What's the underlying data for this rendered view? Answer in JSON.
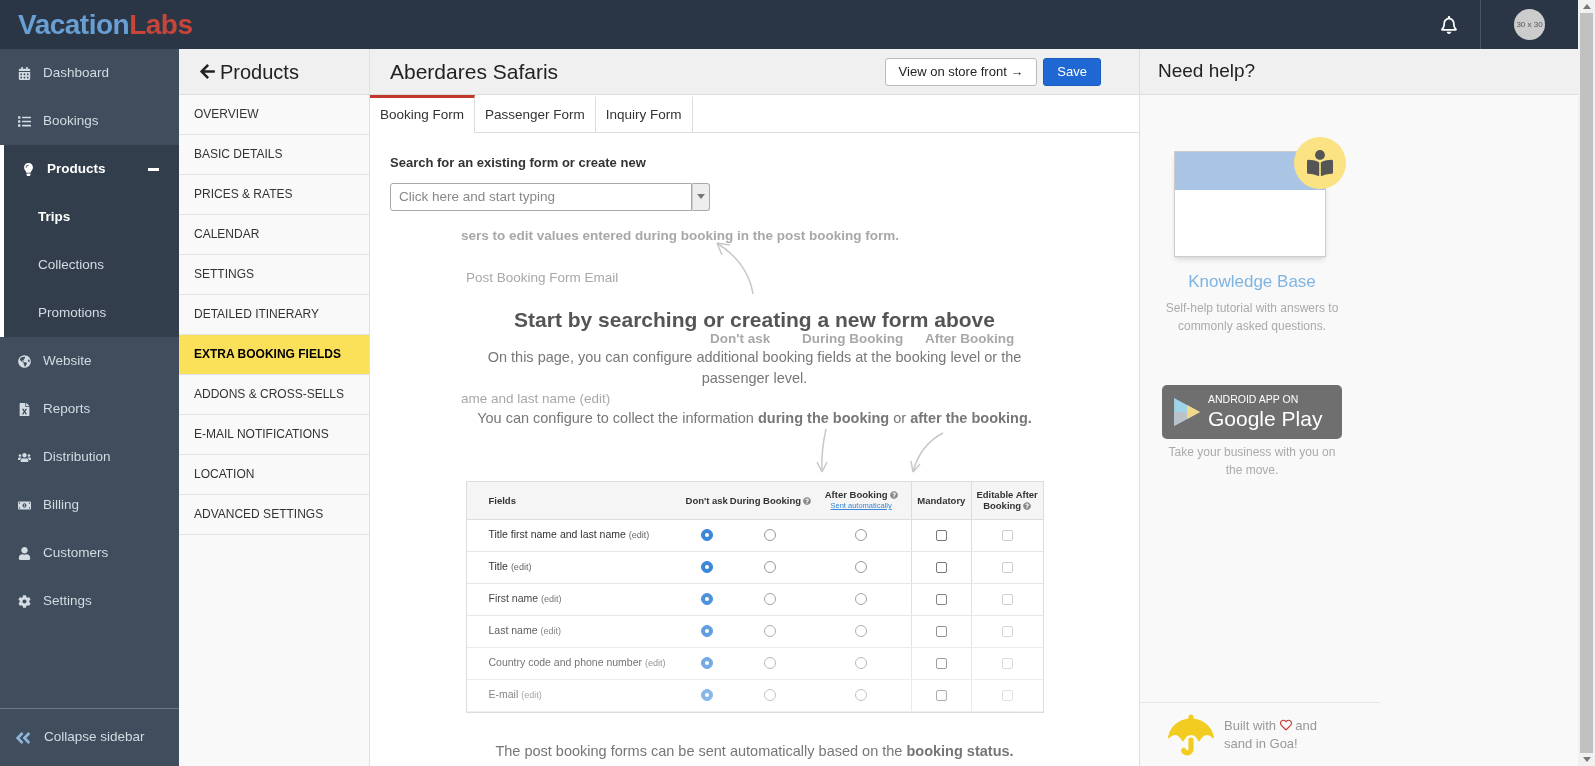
{
  "header": {
    "logo_first": "Vacation",
    "logo_second": "Labs",
    "avatar": "30 x 30"
  },
  "sidebar": {
    "items": [
      {
        "label": "Dashboard",
        "selected": false
      },
      {
        "label": "Bookings",
        "selected": false
      },
      {
        "label": "Products",
        "selected": true,
        "expanded": true,
        "children": [
          {
            "label": "Trips",
            "selected": true
          },
          {
            "label": "Collections",
            "selected": false
          },
          {
            "label": "Promotions",
            "selected": false
          }
        ]
      },
      {
        "label": "Website",
        "selected": false
      },
      {
        "label": "Reports",
        "selected": false
      },
      {
        "label": "Distribution",
        "selected": false
      },
      {
        "label": "Billing",
        "selected": false
      },
      {
        "label": "Customers",
        "selected": false
      },
      {
        "label": "Settings",
        "selected": false
      }
    ],
    "collapse": "Collapse sidebar"
  },
  "subnav": {
    "title": "Products",
    "items": [
      {
        "label": "OVERVIEW",
        "selected": false
      },
      {
        "label": "BASIC DETAILS",
        "selected": false
      },
      {
        "label": "PRICES & RATES",
        "selected": false
      },
      {
        "label": "CALENDAR",
        "selected": false
      },
      {
        "label": "SETTINGS",
        "selected": false
      },
      {
        "label": "DETAILED ITINERARY",
        "selected": false
      },
      {
        "label": "EXTRA BOOKING FIELDS",
        "selected": true
      },
      {
        "label": "ADDONS & CROSS-SELLS",
        "selected": false
      },
      {
        "label": "E-MAIL NOTIFICATIONS",
        "selected": false
      },
      {
        "label": "LOCATION",
        "selected": false
      },
      {
        "label": "ADVANCED SETTINGS",
        "selected": false
      }
    ]
  },
  "main": {
    "title": "Aberdares Safaris",
    "buttons": [
      {
        "label": "View on store front →",
        "kind": "secondary"
      },
      {
        "label": "Save",
        "kind": "primary"
      }
    ],
    "tabs": [
      {
        "label": "Booking Form",
        "selected": true
      },
      {
        "label": "Passenger Form",
        "selected": false
      },
      {
        "label": "Inquiry Form",
        "selected": false
      }
    ],
    "search": {
      "label": "Search for an existing form or create new",
      "placeholder": "Click here and start typing"
    },
    "background_text": [
      {
        "text": "sers to edit values entered during booking in the post booking form.",
        "kind": "bold"
      },
      {
        "text": "Post Booking Form Email",
        "kind": "plain"
      },
      {
        "text": "Don't ask",
        "kind": "bold"
      },
      {
        "text": "During Booking",
        "kind": "bold"
      },
      {
        "text": "After Booking",
        "kind": "bold"
      },
      {
        "text": "ame and last name (edit)",
        "kind": "plain"
      }
    ],
    "intro": {
      "heading": "Start by searching or creating a new form above",
      "paragraphs": [
        "On this page, you can configure additional booking fields at the booking level or the passenger level.",
        "You can configure to collect the information **during the booking** or **after the booking.**"
      ]
    },
    "table": {
      "columns": [
        {
          "label": "Fields",
          "help": false
        },
        {
          "label": "Don't ask",
          "help": false
        },
        {
          "label": "During Booking",
          "help": true
        },
        {
          "label": "After Booking",
          "help": true,
          "link": "Sent automatically"
        },
        {
          "label": "Mandatory",
          "help": false
        },
        {
          "label": "Editable After Booking",
          "help": true
        }
      ],
      "rows": [
        {
          "field": "Title first name and last name",
          "edit": "(edit)",
          "options": [
            {
              "selected": true
            },
            {
              "selected": false
            },
            {
              "selected": false
            }
          ],
          "mandatory": false,
          "editable_after_booking": false
        },
        {
          "field": "Title",
          "edit": "(edit)",
          "options": [
            {
              "selected": true
            },
            {
              "selected": false
            },
            {
              "selected": false
            }
          ],
          "mandatory": false,
          "editable_after_booking": false
        },
        {
          "field": "First name",
          "edit": "(edit)",
          "options": [
            {
              "selected": true
            },
            {
              "selected": false
            },
            {
              "selected": false
            }
          ],
          "mandatory": false,
          "editable_after_booking": false
        },
        {
          "field": "Last name",
          "edit": "(edit)",
          "options": [
            {
              "selected": true
            },
            {
              "selected": false
            },
            {
              "selected": false
            }
          ],
          "mandatory": false,
          "editable_after_booking": false
        },
        {
          "field": "Country code and phone number",
          "edit": "(edit)",
          "options": [
            {
              "selected": true
            },
            {
              "selected": false
            },
            {
              "selected": false
            }
          ],
          "mandatory": false,
          "editable_after_booking": false
        },
        {
          "field": "E-mail",
          "edit": "(edit)",
          "options": [
            {
              "selected": true
            },
            {
              "selected": false
            },
            {
              "selected": false
            }
          ],
          "mandatory": false,
          "editable_after_booking": false
        }
      ]
    },
    "footer_note": "The post booking forms can be sent automatically based on the **booking status.**"
  },
  "help": {
    "title": "Need help?",
    "knowledge_base": {
      "title": "Knowledge Base",
      "description": "Self-help tutorial with answers to commonly asked questions."
    },
    "app_badge": {
      "line1": "ANDROID APP ON",
      "line2": "Google Play"
    },
    "app_caption": "Take your business with you on the move.",
    "credit": {
      "before": "Built with",
      "after": "and sand in Goa!"
    }
  }
}
